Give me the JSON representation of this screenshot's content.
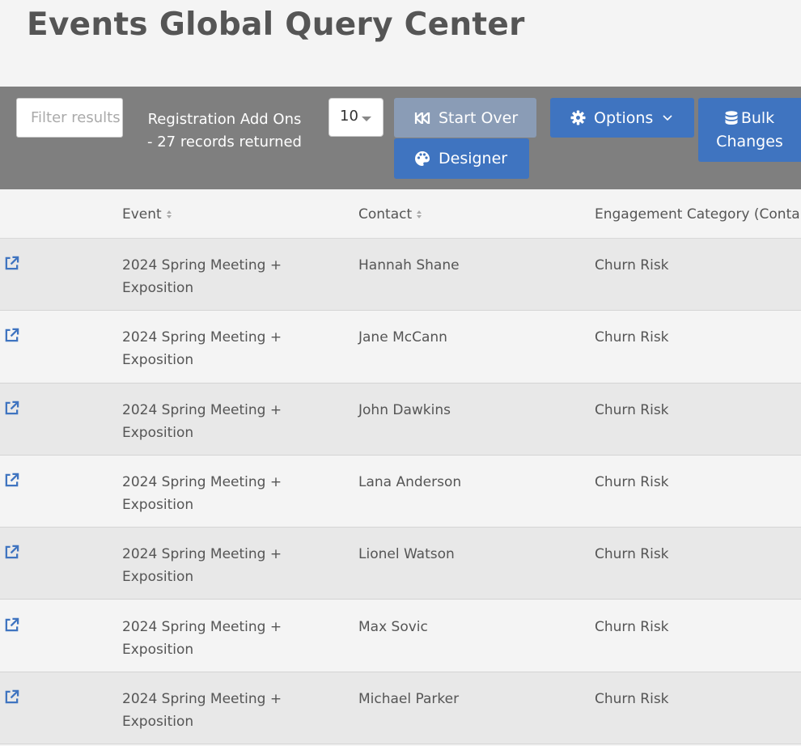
{
  "page": {
    "title": "Events Global Query Center"
  },
  "toolbar": {
    "filter_placeholder": "Filter results",
    "records_line1": "Registration Add Ons",
    "records_line2": "- 27 records returned",
    "page_size": "10",
    "start_over_label": "Start Over",
    "designer_label": "Designer",
    "options_label": "Options",
    "bulk_line1": "Bulk",
    "bulk_line2": "Changes"
  },
  "colors": {
    "accent": "#3f74c0",
    "muted_button": "#8a9cb6",
    "toolbar_bg": "#7f7f7f"
  },
  "icons": {
    "start_over": "fast-backward-icon",
    "designer": "palette-icon",
    "options": "gear-icon",
    "bulk": "database-icon",
    "row_link": "external-link-icon"
  },
  "table": {
    "columns": [
      "Event",
      "Contact",
      "Engagement Category (Conta"
    ],
    "rows": [
      {
        "event": "2024 Spring Meeting + Exposition",
        "contact": "Hannah Shane",
        "category": "Churn Risk"
      },
      {
        "event": "2024 Spring Meeting + Exposition",
        "contact": "Jane McCann",
        "category": "Churn Risk"
      },
      {
        "event": "2024 Spring Meeting + Exposition",
        "contact": "John Dawkins",
        "category": "Churn Risk"
      },
      {
        "event": "2024 Spring Meeting + Exposition",
        "contact": "Lana Anderson",
        "category": "Churn Risk"
      },
      {
        "event": "2024 Spring Meeting + Exposition",
        "contact": "Lionel Watson",
        "category": "Churn Risk"
      },
      {
        "event": "2024 Spring Meeting + Exposition",
        "contact": "Max Sovic",
        "category": "Churn Risk"
      },
      {
        "event": "2024 Spring Meeting + Exposition",
        "contact": "Michael Parker",
        "category": "Churn Risk"
      }
    ]
  }
}
